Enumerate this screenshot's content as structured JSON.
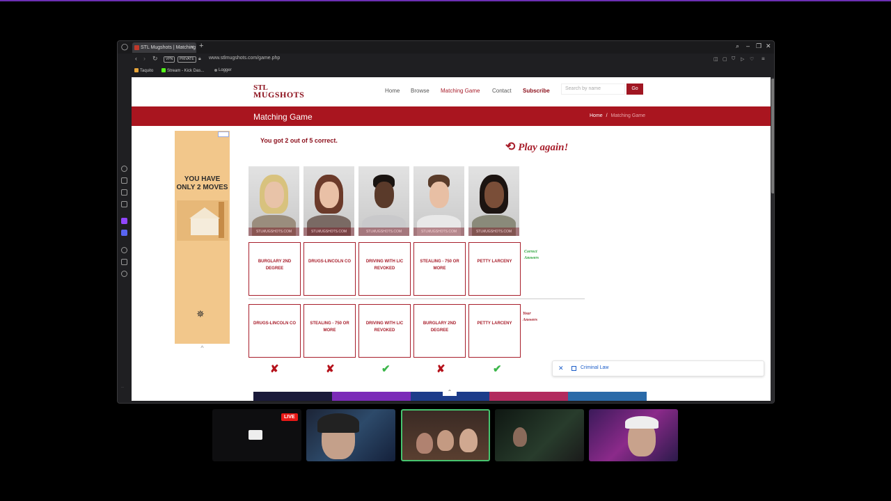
{
  "browser": {
    "tab_title": "STL Mugshots | Matching",
    "new_tab": "+",
    "url": "www.stlmugshots.com/game.php",
    "vpn_label": "VPN",
    "private_label": "PRIVATE",
    "bookmarks": [
      "Taquito",
      "Stream - Kick Das...",
      "Logger"
    ],
    "window_controls": [
      "search-icon",
      "minimize-icon",
      "restore-icon",
      "close-icon"
    ]
  },
  "site": {
    "logo_line1": "STL",
    "logo_line2": "MUGSHOTS",
    "nav": [
      "Home",
      "Browse",
      "Matching Game",
      "Contact",
      "Subscribe"
    ],
    "search_placeholder": "Search by name",
    "search_button": "Go",
    "page_title": "Matching Game",
    "breadcrumb_home": "Home",
    "breadcrumb_sep": "/",
    "breadcrumb_current": "Matching Game",
    "brand_color": "#a9151f"
  },
  "ad": {
    "text": "YOU HAVE ONLY 2 MOVES",
    "collapse": "^"
  },
  "game": {
    "result": "You got 2 out of 5 correct.",
    "play_again": "Play again!",
    "correct_label": "Correct Answers",
    "your_label": "Your Answers",
    "photo_watermark": "STLMUGSHOTS.COM",
    "correct_answers": [
      "BURGLARY 2ND DEGREE",
      "DRUGS-LINCOLN CO",
      "DRIVING WITH LIC REVOKED",
      "STEALING - 750 OR MORE",
      "PETTY LARCENY"
    ],
    "your_answers": [
      "DRUGS-LINCOLN CO",
      "STEALING - 750 OR MORE",
      "DRIVING WITH LIC REVOKED",
      "BURGLARY 2ND DEGREE",
      "PETTY LARCENY"
    ],
    "results": [
      "✘",
      "✘",
      "✔",
      "✘",
      "✔"
    ]
  },
  "toast": {
    "close": "✕",
    "label": "Criminal Law"
  },
  "stream": {
    "live_badge": "LIVE"
  }
}
